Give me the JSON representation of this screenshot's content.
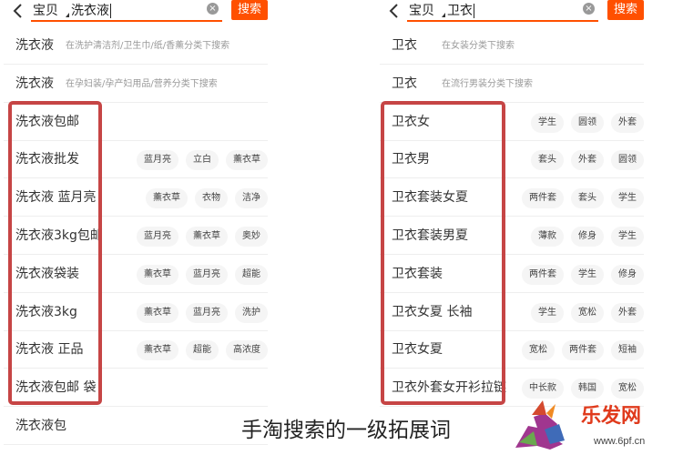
{
  "left_panel": {
    "scope_label": "宝贝",
    "query": "洗衣液",
    "search_button": "搜索",
    "rows": [
      {
        "label": "洗衣液",
        "hint": "在洗护清洁剂/卫生巾/纸/香薰分类下搜索",
        "tags": []
      },
      {
        "label": "洗衣液",
        "hint": "在孕妇装/孕产妇用品/营养分类下搜索",
        "tags": []
      },
      {
        "label": "洗衣液包邮",
        "tags": []
      },
      {
        "label": "洗衣液批发",
        "tags": [
          "蓝月亮",
          "立白",
          "薰衣草"
        ]
      },
      {
        "label": "洗衣液 蓝月亮",
        "tags": [
          "薰衣草",
          "衣物",
          "洁净"
        ]
      },
      {
        "label": "洗衣液3kg包邮",
        "tags": [
          "蓝月亮",
          "薰衣草",
          "奥妙"
        ]
      },
      {
        "label": "洗衣液袋装",
        "tags": [
          "薰衣草",
          "蓝月亮",
          "超能"
        ]
      },
      {
        "label": "洗衣液3kg",
        "tags": [
          "薰衣草",
          "蓝月亮",
          "洗护"
        ]
      },
      {
        "label": "洗衣液 正品",
        "tags": [
          "薰衣草",
          "超能",
          "高浓度"
        ]
      },
      {
        "label": "洗衣液包邮 袋",
        "tags": []
      },
      {
        "label": "洗衣液包",
        "tags": []
      }
    ]
  },
  "right_panel": {
    "scope_label": "宝贝",
    "query": "卫衣",
    "search_button": "搜索",
    "rows": [
      {
        "label": "卫衣",
        "hint": "在女装分类下搜索",
        "tags": []
      },
      {
        "label": "卫衣",
        "hint": "在流行男装分类下搜索",
        "tags": []
      },
      {
        "label": "卫衣女",
        "tags": [
          "学生",
          "圆领",
          "外套"
        ]
      },
      {
        "label": "卫衣男",
        "tags": [
          "套头",
          "外套",
          "圆领"
        ]
      },
      {
        "label": "卫衣套装女夏",
        "tags": [
          "两件套",
          "套头",
          "学生"
        ]
      },
      {
        "label": "卫衣套装男夏",
        "tags": [
          "薄款",
          "修身",
          "学生"
        ]
      },
      {
        "label": "卫衣套装",
        "tags": [
          "两件套",
          "学生",
          "修身"
        ]
      },
      {
        "label": "卫衣女夏 长袖",
        "tags": [
          "学生",
          "宽松",
          "外套"
        ]
      },
      {
        "label": "卫衣女夏",
        "tags": [
          "宽松",
          "两件套",
          "短袖"
        ]
      },
      {
        "label": "卫衣外套女开衫拉链",
        "tags": [
          "中长款",
          "韩国",
          "宽松"
        ]
      }
    ]
  },
  "caption": "手淘搜索的一级拓展词",
  "logo": {
    "brand": "乐发网",
    "url": "www.6pf.cn"
  },
  "colors": {
    "accent": "#ff5000",
    "highlight_border": "#c64545",
    "tag_bg": "#f5f5f5"
  }
}
